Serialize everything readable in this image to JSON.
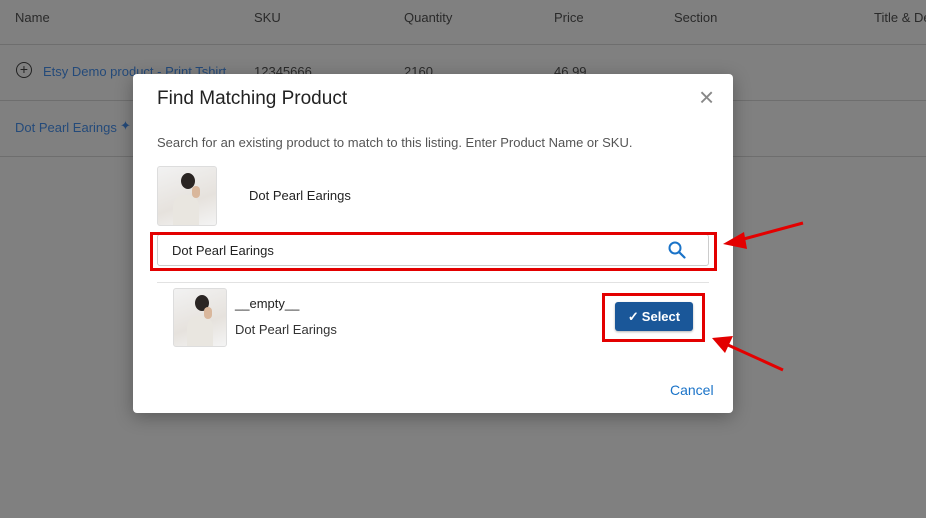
{
  "table": {
    "headers": [
      "Name",
      "SKU",
      "Quantity",
      "Price",
      "Section",
      "Title & De"
    ],
    "rows": [
      {
        "name": "Etsy Demo product - Print Tshirt",
        "sku": "12345666",
        "quantity": "2160",
        "price": "46.99"
      },
      {
        "name": "Dot Pearl Earings"
      }
    ]
  },
  "modal": {
    "title": "Find Matching Product",
    "description": "Search for an existing product to match to this listing. Enter Product Name or SKU.",
    "listing_name": "Dot Pearl Earings",
    "search": {
      "value": "Dot Pearl Earings",
      "icon": "search-icon"
    },
    "result": {
      "sku": "__empty__",
      "name": "Dot Pearl Earings",
      "select_label": "Select"
    },
    "cancel_label": "Cancel",
    "close_icon": "close-icon"
  },
  "colors": {
    "primary": "#1a5799",
    "annotation": "#e30000",
    "link": "#1a73c8"
  }
}
